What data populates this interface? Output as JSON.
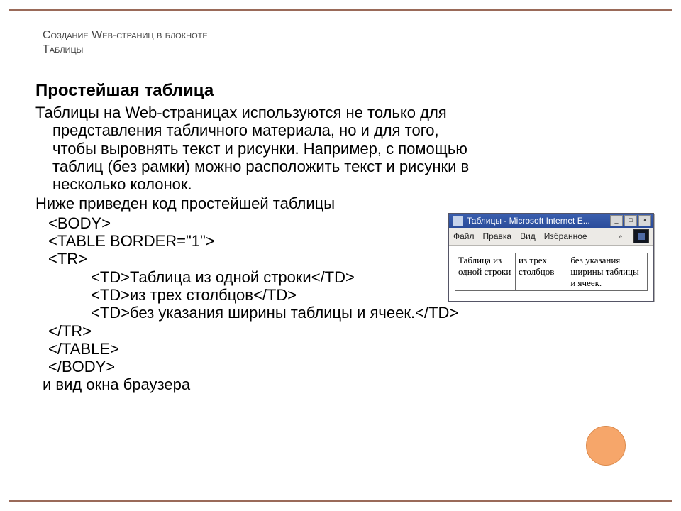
{
  "pretitle": {
    "line1": "Создание Web-страниц в блокноте",
    "line2": "Таблицы"
  },
  "heading": "Простейшая таблица",
  "paragraph": {
    "l1": "Таблицы на Web-страницах используются не только для",
    "l2": "представления табличного материала, но и для того,",
    "l3": "чтобы выровнять текст и рисунки. Например, с помощью",
    "l4": "таблиц (без рамки) можно расположить текст и рисунки в",
    "l5": "несколько колонок."
  },
  "lead2": "Ниже приведен код простейшей таблицы",
  "code": {
    "body_open": "<BODY>",
    "table_open": "<TABLE BORDER=\"1\">",
    "tr_open": "<TR>",
    "td1": "<TD>Таблица из одной строки</TD>",
    "td2": "<TD>из трех столбцов</TD>",
    "td3": "<TD>без указания ширины таблицы и ячеек.</TD>",
    "tr_close": "</TR>",
    "table_close": "</TABLE>",
    "body_close": "</BODY>"
  },
  "closing": "и вид окна браузера",
  "iewindow": {
    "title": "Таблицы - Microsoft Internet E...",
    "btn_min": "_",
    "btn_max": "□",
    "btn_close": "×",
    "menu": {
      "file": "Файл",
      "edit": "Правка",
      "view": "Вид",
      "fav": "Избранное",
      "chev": "»"
    },
    "cells": {
      "c1": "Таблица из одной строки",
      "c2": "из трех столбцов",
      "c3": "без указания ширины таблицы и ячеек."
    }
  }
}
